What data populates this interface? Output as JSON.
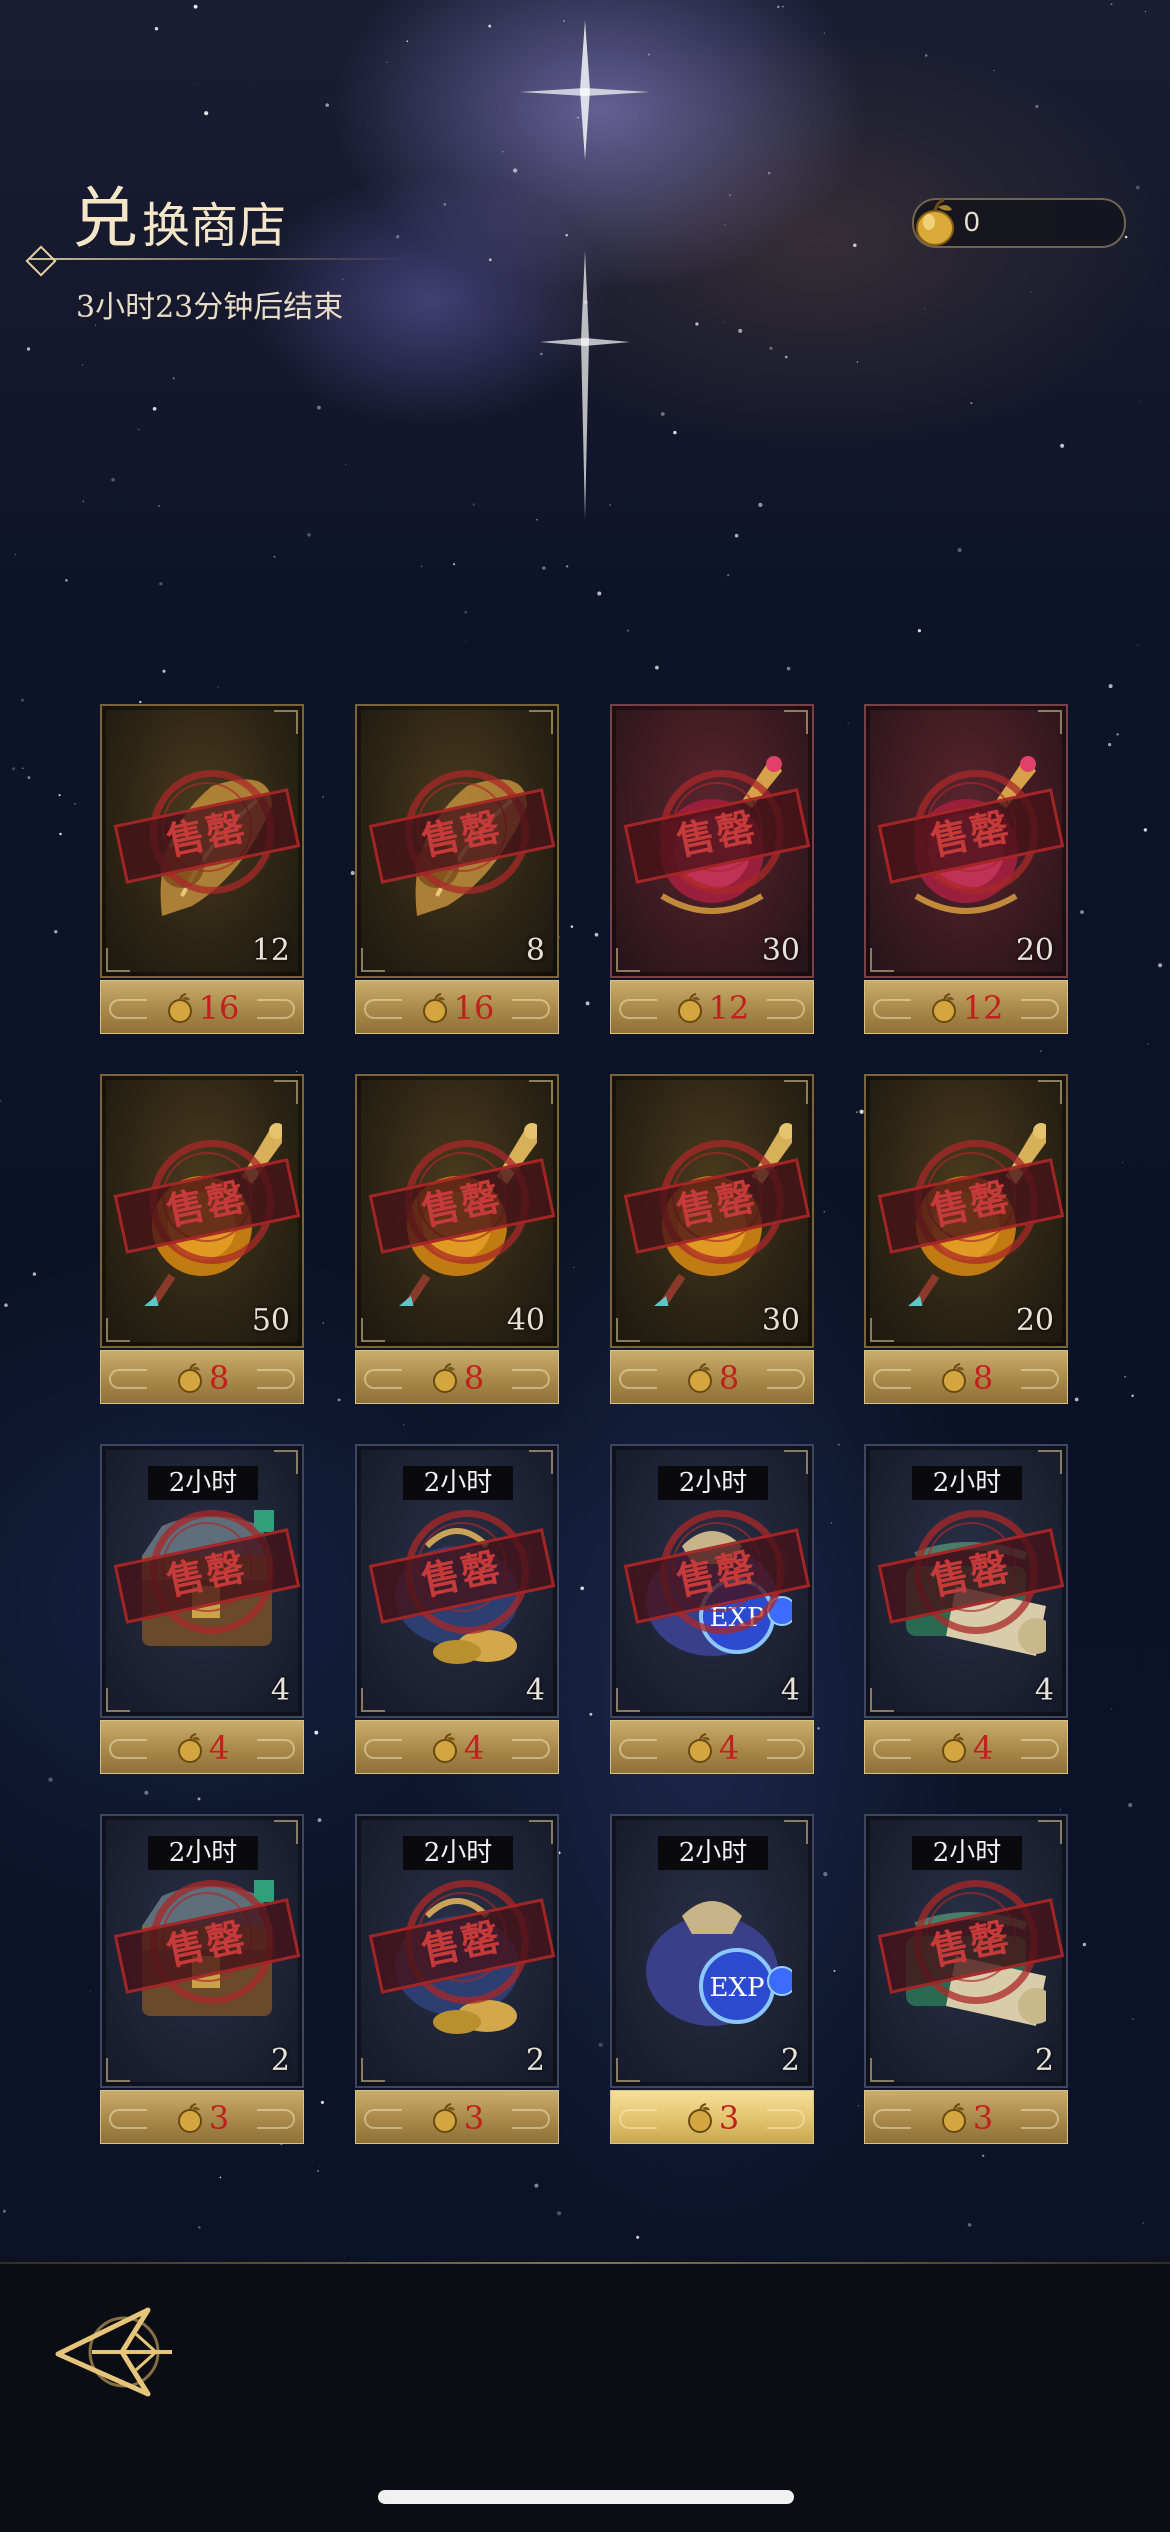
{
  "header": {
    "title_first_char": "兑",
    "title_rest": "换商店",
    "timer_text": "3小时23分钟后结束",
    "currency_icon": "golden-apple-icon",
    "currency_value": "0"
  },
  "sold_out_label": "售罄",
  "colors": {
    "price_text": "#c21f1f",
    "soldout_red": "#c63a3a",
    "gold_bar": "#c9ad6a"
  },
  "items": [
    {
      "item": "golden-feather",
      "qty": "12",
      "price": "16",
      "tag": "",
      "sold_out": true
    },
    {
      "item": "golden-feather",
      "qty": "8",
      "price": "16",
      "tag": "",
      "sold_out": true
    },
    {
      "item": "crimson-amulet",
      "qty": "30",
      "price": "12",
      "tag": "",
      "sold_out": true
    },
    {
      "item": "crimson-amulet",
      "qty": "20",
      "price": "12",
      "tag": "",
      "sold_out": true
    },
    {
      "item": "amber-amulet",
      "qty": "50",
      "price": "8",
      "tag": "",
      "sold_out": true
    },
    {
      "item": "amber-amulet",
      "qty": "40",
      "price": "8",
      "tag": "",
      "sold_out": true
    },
    {
      "item": "amber-amulet",
      "qty": "30",
      "price": "8",
      "tag": "",
      "sold_out": true
    },
    {
      "item": "amber-amulet",
      "qty": "20",
      "price": "8",
      "tag": "",
      "sold_out": true
    },
    {
      "item": "treasure-chest",
      "qty": "4",
      "price": "4",
      "tag": "2小时",
      "sold_out": true
    },
    {
      "item": "gold-coin-pouch",
      "qty": "4",
      "price": "4",
      "tag": "2小时",
      "sold_out": true
    },
    {
      "item": "exp-bag",
      "qty": "4",
      "price": "4",
      "tag": "2小时",
      "sold_out": true
    },
    {
      "item": "scroll-bundle",
      "qty": "4",
      "price": "4",
      "tag": "2小时",
      "sold_out": true
    },
    {
      "item": "treasure-chest",
      "qty": "2",
      "price": "3",
      "tag": "2小时",
      "sold_out": true
    },
    {
      "item": "gold-coin-pouch",
      "qty": "2",
      "price": "3",
      "tag": "2小时",
      "sold_out": true
    },
    {
      "item": "exp-bag",
      "qty": "2",
      "price": "3",
      "tag": "2小时",
      "sold_out": false
    },
    {
      "item": "scroll-bundle",
      "qty": "2",
      "price": "3",
      "tag": "2小时",
      "sold_out": true
    }
  ],
  "exp_label": "EXP",
  "nav": {
    "back_icon": "back-arrow-emblem-icon"
  }
}
